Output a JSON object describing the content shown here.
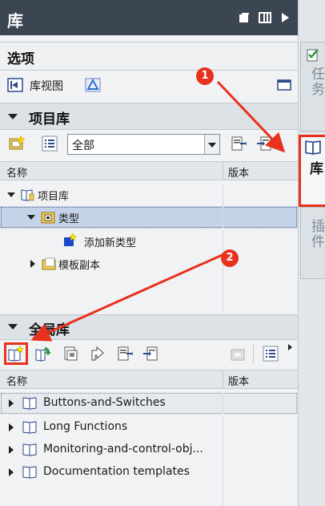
{
  "header": {
    "title": "库"
  },
  "options": {
    "title": "选项",
    "library_view_label": "库视图"
  },
  "project_library": {
    "title": "项目库",
    "filter_value": "全部",
    "col_name": "名称",
    "col_version": "版本",
    "tree": [
      {
        "label": "项目库"
      },
      {
        "label": "类型"
      },
      {
        "label": "添加新类型"
      },
      {
        "label": "模板副本"
      }
    ]
  },
  "global_library": {
    "title": "全局库",
    "col_name": "名称",
    "col_version": "版本",
    "items": [
      {
        "label": "Buttons-and-Switches"
      },
      {
        "label": "Long Functions"
      },
      {
        "label": "Monitoring-and-control-obj..."
      },
      {
        "label": "Documentation templates"
      }
    ]
  },
  "side_tabs": {
    "tasks": "任务",
    "libraries": "库",
    "addins": "插件"
  },
  "annotations": {
    "badge1": "1",
    "badge2": "2"
  },
  "colors": {
    "accent_red": "#e8321e",
    "header_bg": "#3c4552",
    "selection": "#c5d3e8"
  },
  "icons": [
    "grid-icon",
    "columns-icon",
    "play-right-icon",
    "library-view-icon",
    "open-library-icon",
    "add-library-icon"
  ]
}
